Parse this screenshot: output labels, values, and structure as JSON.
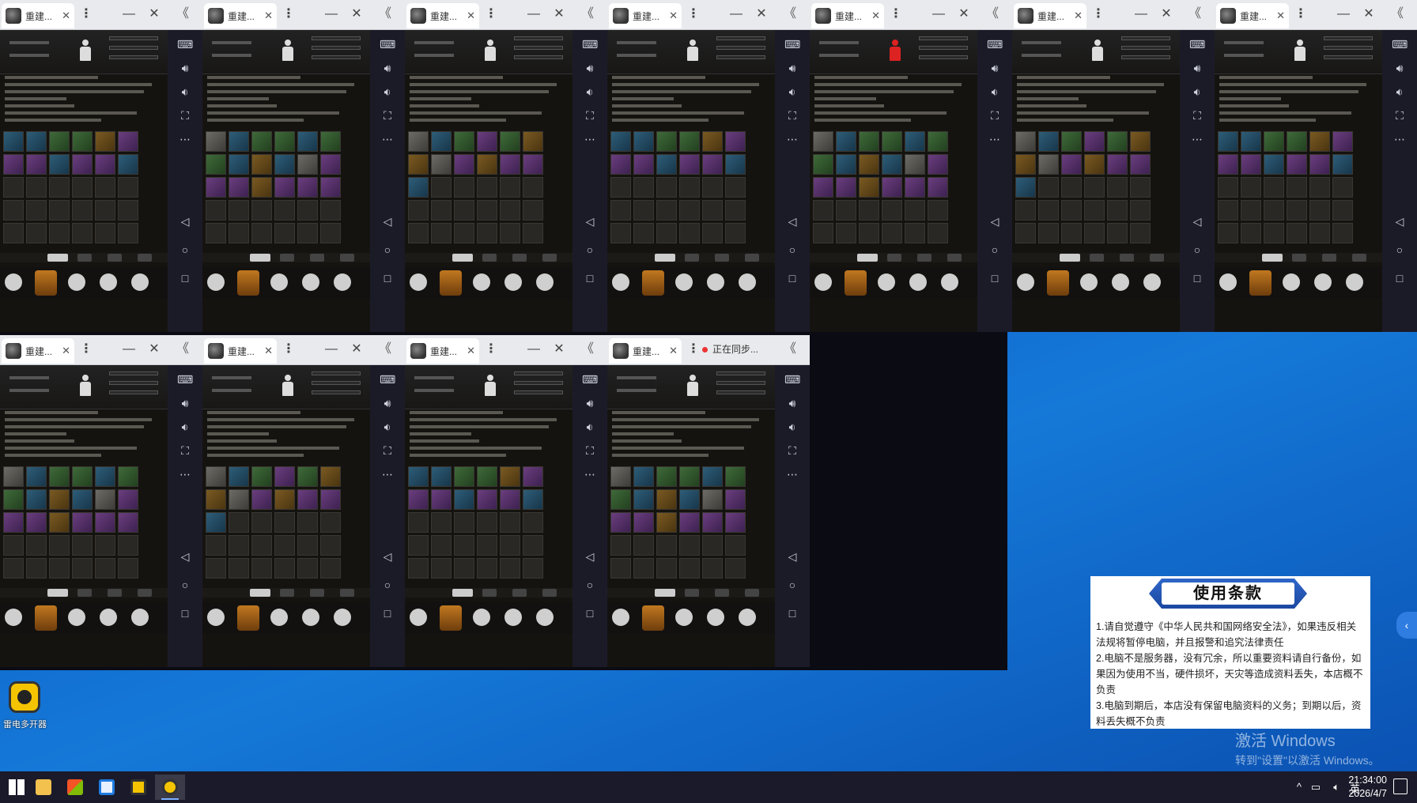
{
  "window": {
    "tab_title": "重建...",
    "close_glyph": "✕",
    "more_glyph": "⋮",
    "minimize_glyph": "—",
    "collapse_glyph": "《",
    "sync_text": "正在同步..."
  },
  "emulators": [
    {
      "id": 1,
      "avatar_alert": false
    },
    {
      "id": 2,
      "avatar_alert": false
    },
    {
      "id": 3,
      "avatar_alert": false
    },
    {
      "id": 4,
      "avatar_alert": false
    },
    {
      "id": 5,
      "avatar_alert": true
    },
    {
      "id": 6,
      "avatar_alert": false
    },
    {
      "id": 7,
      "avatar_alert": false
    },
    {
      "id": 8,
      "avatar_alert": false
    },
    {
      "id": 9,
      "avatar_alert": false
    },
    {
      "id": 10,
      "avatar_alert": false
    },
    {
      "id": 11,
      "avatar_alert": false,
      "syncing": true
    }
  ],
  "emulator_sidebar_icons": [
    "keyboard-icon",
    "volume-up-icon",
    "volume-down-icon",
    "screenshot-icon",
    "more-icon",
    "back-icon",
    "home-icon",
    "recent-apps-icon"
  ],
  "emulator_nav_icons": [
    "globe-icon",
    "backpack-icon",
    "character-icon",
    "trash-icon",
    "shop-cart-icon"
  ],
  "terms": {
    "title": "使用条款",
    "items": [
      "1.请自觉遵守《中华人民共和国网络安全法》，如果违反相关法规将暂停电脑，并且报警和追究法律责任",
      "2.电脑不是服务器，没有冗余，所以重要资料请自行备份，如果因为使用不当，硬件损坏，天灾等造成资料丢失，本店概不负责",
      "3.电脑到期后，本店没有保留电脑资料的义务；到期以后，资料丢失概不负责"
    ]
  },
  "activation": {
    "title": "激活 Windows",
    "subtitle": "转到\"设置\"以激活 Windows。"
  },
  "desktop_icons": [
    {
      "label": "雷电多开器",
      "icon": "multi-instance-icon"
    }
  ],
  "taskbar": {
    "apps": [
      "windows-start-icon",
      "file-explorer-icon",
      "store-icon",
      "remote-desktop-icon",
      "ldplayer-icon",
      "multi-instance-icon"
    ],
    "tray_chevron": "^",
    "ime": "英",
    "time": "21:34:00",
    "date": "2026/4/7"
  },
  "colors": {
    "accent": "#2f66c9",
    "desktop": "#0d5fc8",
    "taskbar": "#1a1a2a"
  }
}
